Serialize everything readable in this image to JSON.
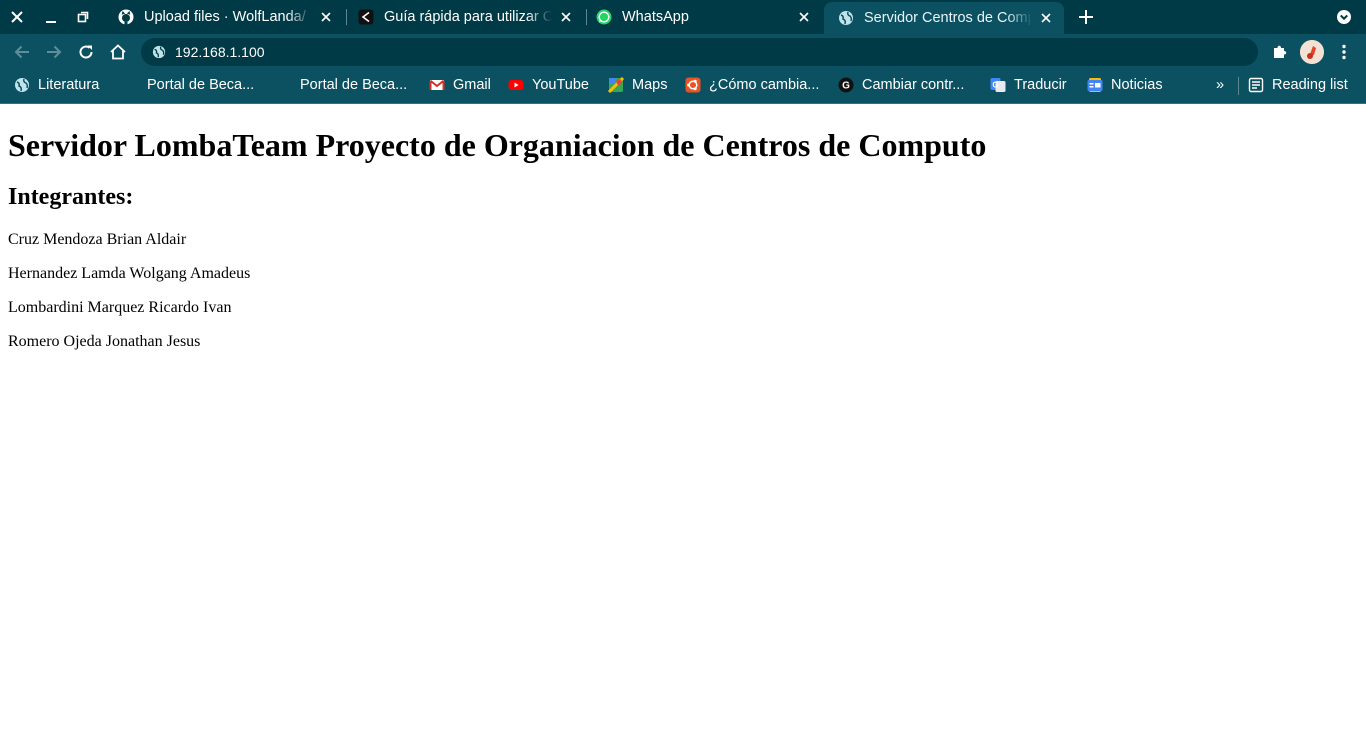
{
  "browser": {
    "tabs": [
      {
        "title": "Upload files · WolfLanda/",
        "favicon": "github-icon",
        "active": false
      },
      {
        "title": "Guía rápida para utilizar C",
        "favicon": "share-icon",
        "active": false
      },
      {
        "title": "WhatsApp",
        "favicon": "whatsapp-icon",
        "active": false
      },
      {
        "title": "Servidor Centros de Comp",
        "favicon": "globe-icon",
        "active": true
      }
    ],
    "address_bar": {
      "url": "192.168.1.100"
    },
    "bookmarks": [
      {
        "label": "Literatura",
        "icon": "globe-icon"
      },
      {
        "label": "Portal de Beca...",
        "icon": "moon-icon"
      },
      {
        "label": "Portal de Beca...",
        "icon": "moon-icon"
      },
      {
        "label": "Gmail",
        "icon": "gmail-icon"
      },
      {
        "label": "YouTube",
        "icon": "youtube-icon"
      },
      {
        "label": "Maps",
        "icon": "maps-icon"
      },
      {
        "label": "¿Cómo cambia...",
        "icon": "ubuntu-icon"
      },
      {
        "label": "Cambiar contr...",
        "icon": "g-icon"
      },
      {
        "label": "Traducir",
        "icon": "translate-icon"
      },
      {
        "label": "Noticias",
        "icon": "news-icon"
      }
    ],
    "reading_list_label": "Reading list",
    "overflow_label": "»",
    "colors": {
      "frame": "#003a46",
      "toolbar": "#0b5161",
      "omnibox": "#003a46"
    }
  },
  "page": {
    "title": "Servidor LombaTeam Proyecto de Organiacion de Centros de Computo",
    "subtitle": "Integrantes:",
    "members": [
      "Cruz Mendoza Brian Aldair",
      "Hernandez Lamda Wolgang Amadeus",
      "Lombardini Marquez Ricardo Ivan",
      "Romero Ojeda Jonathan Jesus"
    ]
  }
}
